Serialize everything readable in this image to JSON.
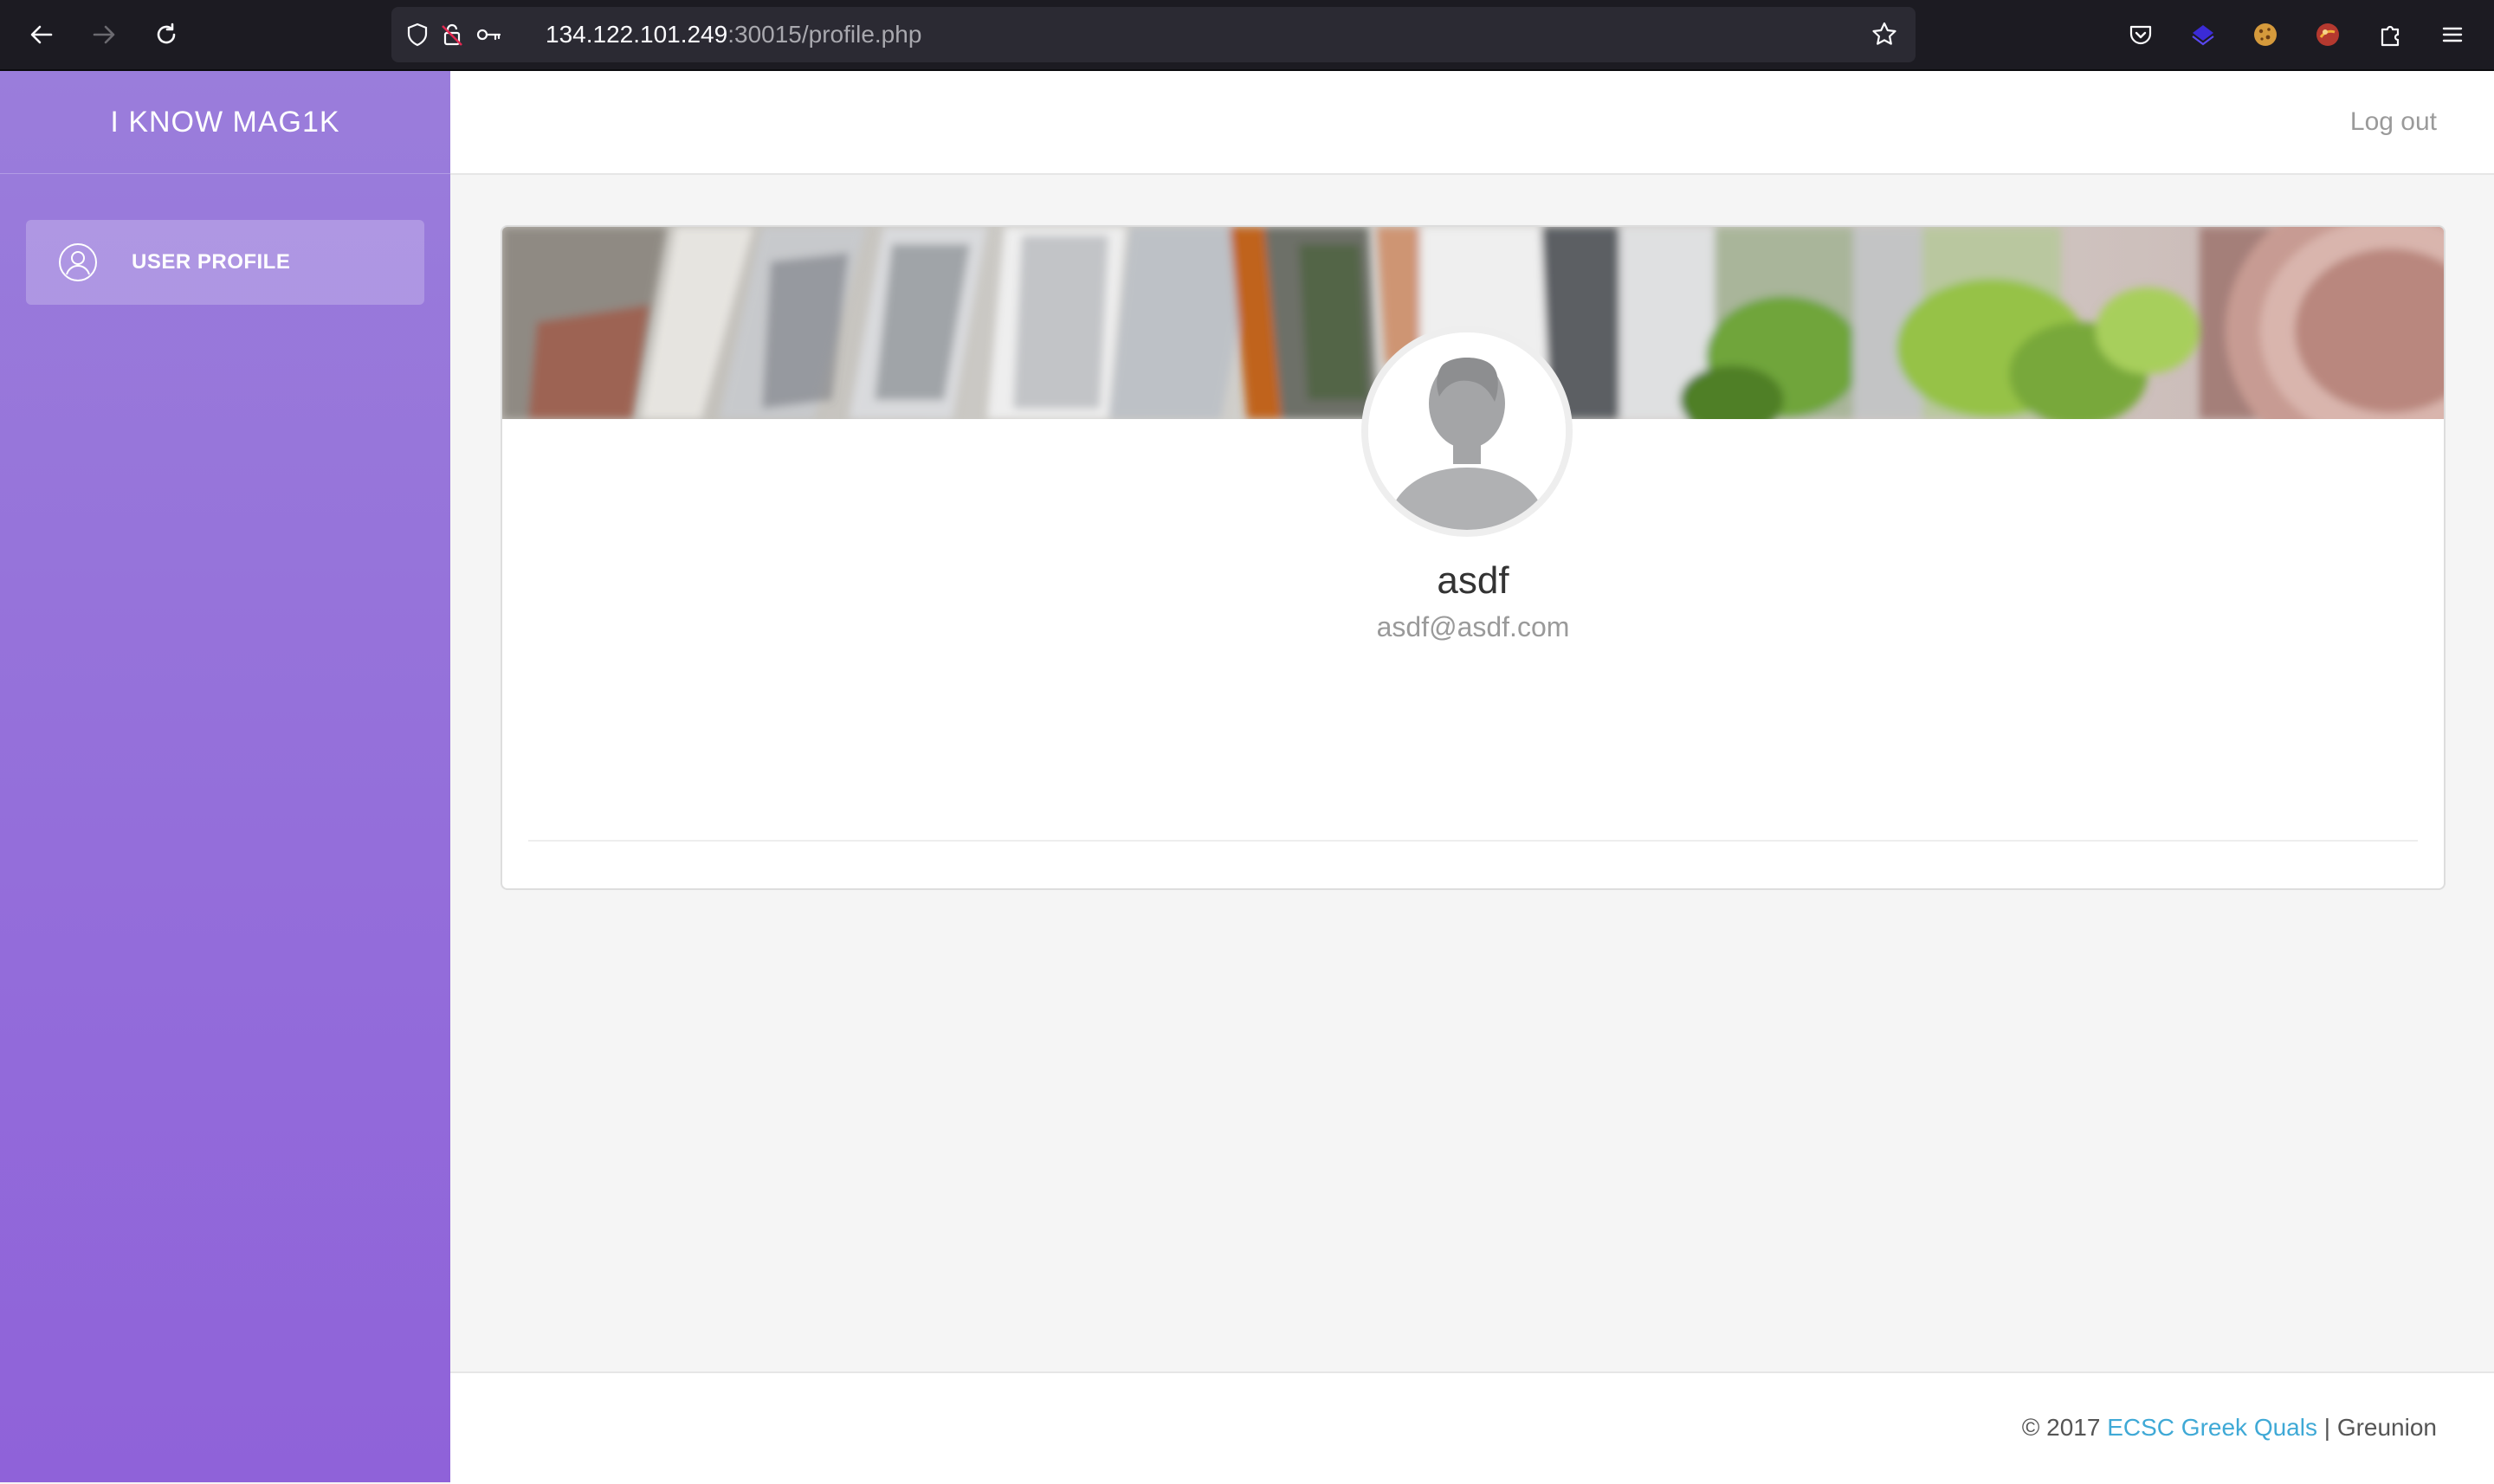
{
  "browser": {
    "url_host": "134.122.101.249",
    "url_rest": ":30015/profile.php",
    "icons": [
      "back-icon",
      "forward-icon",
      "reload-icon",
      "shield-icon",
      "insecure-lock-icon",
      "key-icon",
      "bookmark-star-icon",
      "pocket-icon",
      "extension-icon",
      "cookie-icon",
      "extension-icon",
      "puzzle-icon",
      "menu-icon"
    ]
  },
  "sidebar": {
    "brand": "I KNOW MAG1K",
    "items": [
      {
        "label": "USER PROFILE",
        "icon": "user-icon"
      }
    ]
  },
  "topbar": {
    "logout_label": "Log out"
  },
  "profile": {
    "username": "asdf",
    "email": "asdf@asdf.com"
  },
  "footer": {
    "copyright": "© 2017",
    "link_text": "ECSC Greek Quals",
    "separator": "|",
    "suffix": "Greunion"
  },
  "colors": {
    "sidebar_top": "#9a7ddb",
    "sidebar_bottom": "#8f62d9",
    "footer_link": "#3fa9d6",
    "chrome_bg": "#1c1b22"
  }
}
